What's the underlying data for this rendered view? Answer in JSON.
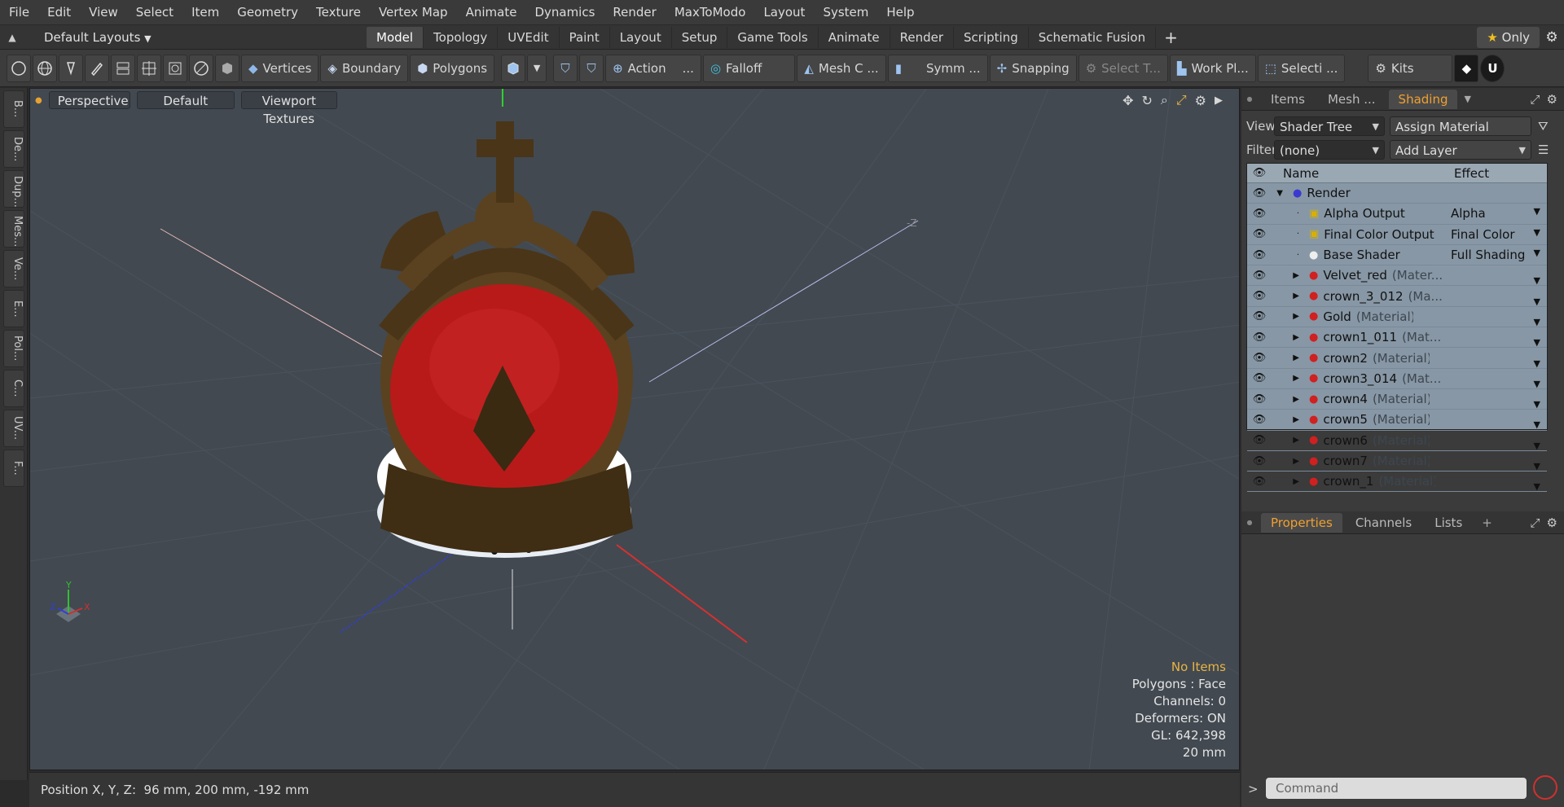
{
  "menu": [
    "File",
    "Edit",
    "View",
    "Select",
    "Item",
    "Geometry",
    "Texture",
    "Vertex Map",
    "Animate",
    "Dynamics",
    "Render",
    "MaxToModo",
    "Layout",
    "System",
    "Help"
  ],
  "layout_selector": "Default Layouts",
  "layout_tabs": [
    {
      "label": "Model",
      "active": true
    },
    {
      "label": "Topology"
    },
    {
      "label": "UVEdit"
    },
    {
      "label": "Paint"
    },
    {
      "label": "Layout"
    },
    {
      "label": "Setup"
    },
    {
      "label": "Game Tools"
    },
    {
      "label": "Animate"
    },
    {
      "label": "Render"
    },
    {
      "label": "Scripting"
    },
    {
      "label": "Schematic Fusion"
    }
  ],
  "only_button": "Only",
  "toolbar": {
    "vertices": "Vertices",
    "boundary": "Boundary",
    "polygons": "Polygons",
    "action": "Action",
    "falloff": "Falloff",
    "mesh": "Mesh C ...",
    "symm": "Symm ...",
    "snapping": "Snapping",
    "select": "Select T...",
    "workplane": "Work Pl...",
    "selection": "Selecti ...",
    "kits": "Kits"
  },
  "left_tabs": [
    "B...",
    "De...",
    "Dup...",
    "Mes...",
    "Ve...",
    "E...",
    "Pol...",
    "C...",
    "UV...",
    "F..."
  ],
  "viewport": {
    "perspective": "Perspective",
    "default": "Default",
    "textures": "Viewport Textures",
    "axis_label": "-Z",
    "stats": {
      "items": "No Items",
      "polygons": "Polygons : Face",
      "channels": "Channels: 0",
      "deformers": "Deformers: ON",
      "gl": "GL: 642,398",
      "scale": "20 mm"
    }
  },
  "status": "Position X, Y, Z:  96 mm, 200 mm, -192 mm",
  "panel_tabs": [
    "Items",
    "Mesh ...",
    "Shading"
  ],
  "shading": {
    "view_label": "View",
    "view_value": "Shader Tree",
    "assign": "Assign Material",
    "filter_label": "Filter",
    "filter_value": "(none)",
    "add_layer": "Add Layer",
    "col_name": "Name",
    "col_effect": "Effect",
    "rows": [
      {
        "name": "Render",
        "sub": "",
        "effect": "",
        "kind": "render"
      },
      {
        "name": "Alpha Output",
        "sub": "",
        "effect": "Alpha",
        "kind": "output"
      },
      {
        "name": "Final Color Output",
        "sub": "",
        "effect": "Final Color",
        "kind": "output"
      },
      {
        "name": "Base Shader",
        "sub": "",
        "effect": "Full Shading",
        "kind": "shader"
      },
      {
        "name": "Velvet_red",
        "sub": "(Mater...",
        "effect": "",
        "kind": "mat"
      },
      {
        "name": "crown_3_012",
        "sub": "(Ma...",
        "effect": "",
        "kind": "mat"
      },
      {
        "name": "Gold",
        "sub": "(Material)",
        "effect": "",
        "kind": "mat"
      },
      {
        "name": "crown1_011",
        "sub": "(Mat...",
        "effect": "",
        "kind": "mat"
      },
      {
        "name": "crown2",
        "sub": "(Material)",
        "effect": "",
        "kind": "mat"
      },
      {
        "name": "crown3_014",
        "sub": "(Mat...",
        "effect": "",
        "kind": "mat"
      },
      {
        "name": "crown4",
        "sub": "(Material)",
        "effect": "",
        "kind": "mat"
      },
      {
        "name": "crown5",
        "sub": "(Material)",
        "effect": "",
        "kind": "mat"
      },
      {
        "name": "crown6",
        "sub": "(Material)",
        "effect": "",
        "kind": "mat"
      },
      {
        "name": "crown7",
        "sub": "(Material)",
        "effect": "",
        "kind": "mat"
      },
      {
        "name": "crown_1",
        "sub": "(Material)",
        "effect": "",
        "kind": "mat"
      }
    ]
  },
  "lower_tabs": [
    "Properties",
    "Channels",
    "Lists"
  ],
  "command_placeholder": "Command",
  "colors": {
    "accent": "#f0a030",
    "viewport_bg": "#424951",
    "velvet": "#b81a1a",
    "gold": "#4a3518"
  }
}
